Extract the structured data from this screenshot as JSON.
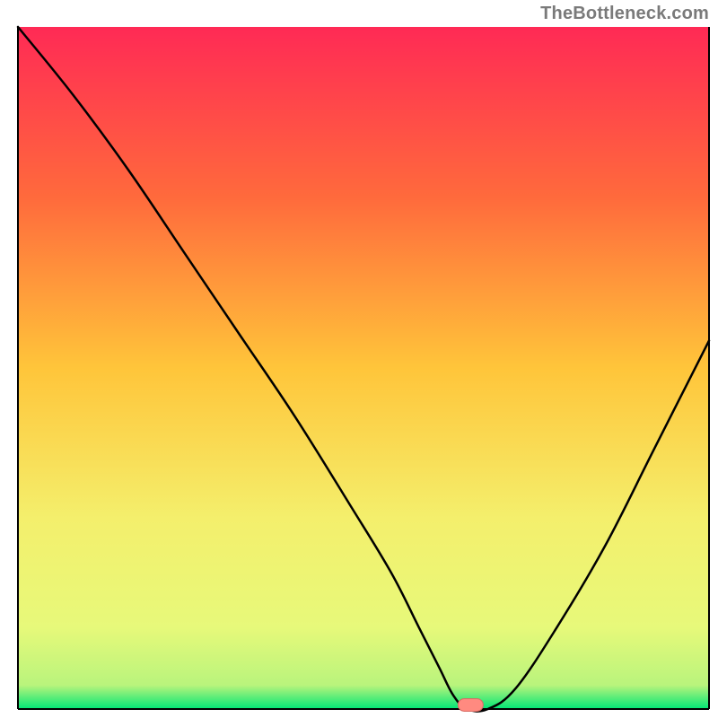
{
  "watermark": "TheBottleneck.com",
  "colors": {
    "gradient_top": "#ff2a55",
    "gradient_mid1": "#ff7a3c",
    "gradient_mid2": "#ffd23a",
    "gradient_mid3": "#f7f06a",
    "gradient_bottom": "#00e676",
    "curve": "#000000",
    "marker_fill": "#ff8a80",
    "marker_stroke": "#d96b63",
    "axis": "#000000"
  },
  "chart_data": {
    "type": "line",
    "title": "",
    "xlabel": "",
    "ylabel": "",
    "xlim": [
      0,
      100
    ],
    "ylim": [
      0,
      100
    ],
    "x": [
      0,
      8,
      16,
      24,
      32,
      40,
      48,
      54,
      58,
      61,
      63,
      65,
      68,
      72,
      78,
      85,
      92,
      100
    ],
    "y": [
      100,
      90,
      79,
      67,
      55,
      43,
      30,
      20,
      12,
      6,
      2,
      0,
      0,
      3,
      12,
      24,
      38,
      54
    ],
    "marker": {
      "x": 65.5,
      "y": 0.6
    },
    "gradient_stops": [
      {
        "offset": 0.0,
        "color": "#ff2a55"
      },
      {
        "offset": 0.25,
        "color": "#ff6a3c"
      },
      {
        "offset": 0.5,
        "color": "#ffc53a"
      },
      {
        "offset": 0.72,
        "color": "#f4ef6c"
      },
      {
        "offset": 0.88,
        "color": "#e7f97a"
      },
      {
        "offset": 0.965,
        "color": "#b9f47c"
      },
      {
        "offset": 1.0,
        "color": "#00e676"
      }
    ]
  }
}
